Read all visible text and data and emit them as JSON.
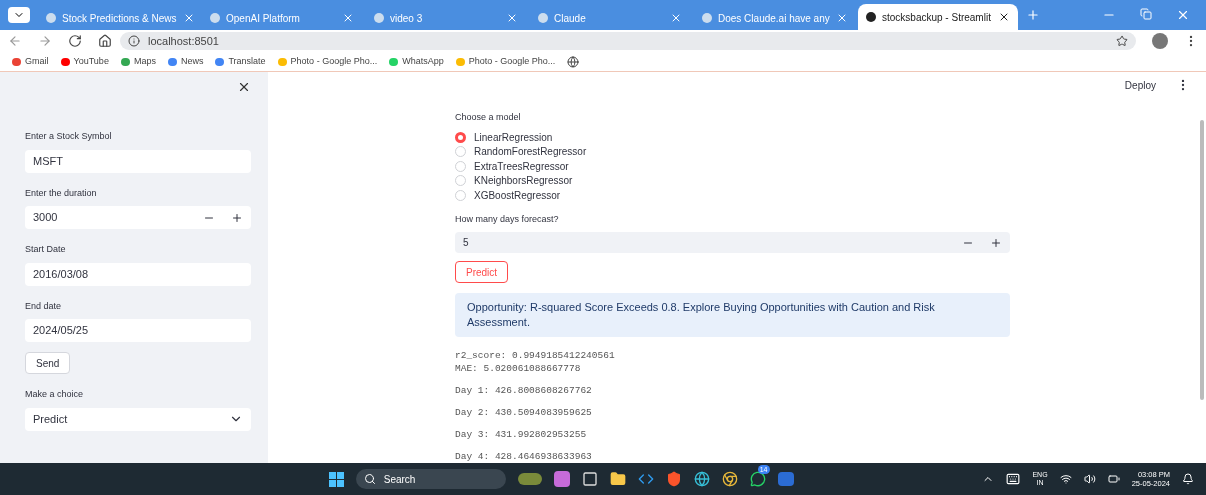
{
  "browser": {
    "tabs": [
      {
        "title": "Stock Predictions & News",
        "selected": false
      },
      {
        "title": "OpenAI Platform",
        "selected": false
      },
      {
        "title": "video 3",
        "selected": false
      },
      {
        "title": "Claude",
        "selected": false
      },
      {
        "title": "Does Claude.ai have any",
        "selected": false
      },
      {
        "title": "stocksbackup - Streamlit",
        "selected": true
      }
    ],
    "url": "localhost:8501",
    "bookmarks": [
      "Gmail",
      "YouTube",
      "Maps",
      "News",
      "Translate",
      "Photo - Google Pho...",
      "WhatsApp",
      "Photo - Google Pho..."
    ]
  },
  "sidebar": {
    "fields": [
      {
        "label": "Enter a Stock Symbol",
        "value": "MSFT",
        "kind": "text"
      },
      {
        "label": "Enter the duration",
        "value": "3000",
        "kind": "number"
      },
      {
        "label": "Start Date",
        "value": "2016/03/08",
        "kind": "text"
      },
      {
        "label": "End date",
        "value": "2024/05/25",
        "kind": "text"
      }
    ],
    "send": "Send",
    "choice_label": "Make a choice",
    "choice": "Predict"
  },
  "header": {
    "deploy": "Deploy"
  },
  "main": {
    "model_label": "Choose a model",
    "models": [
      {
        "label": "LinearRegression",
        "selected": true
      },
      {
        "label": "RandomForestRegressor",
        "selected": false
      },
      {
        "label": "ExtraTreesRegressor",
        "selected": false
      },
      {
        "label": "KNeighborsRegressor",
        "selected": false
      },
      {
        "label": "XGBoostRegressor",
        "selected": false
      }
    ],
    "days_label": "How many days forecast?",
    "days": "5",
    "predict": "Predict",
    "info": "Opportunity: R-squared Score Exceeds 0.8. Explore Buying Opportunities with Caution and Risk Assessment.",
    "metrics": [
      "r2_score: 0.9949185412240561",
      "MAE: 5.020061088667778"
    ],
    "forecast": [
      "Day 1: 426.8008608267762",
      "Day 2: 430.5094083959625",
      "Day 3: 431.992802953255",
      "Day 4: 428.4646938633963"
    ]
  },
  "taskbar": {
    "search": "Search",
    "badge": "14",
    "lang": "ENG",
    "region": "IN",
    "time": "03:08 PM",
    "date": "25-05-2024"
  }
}
